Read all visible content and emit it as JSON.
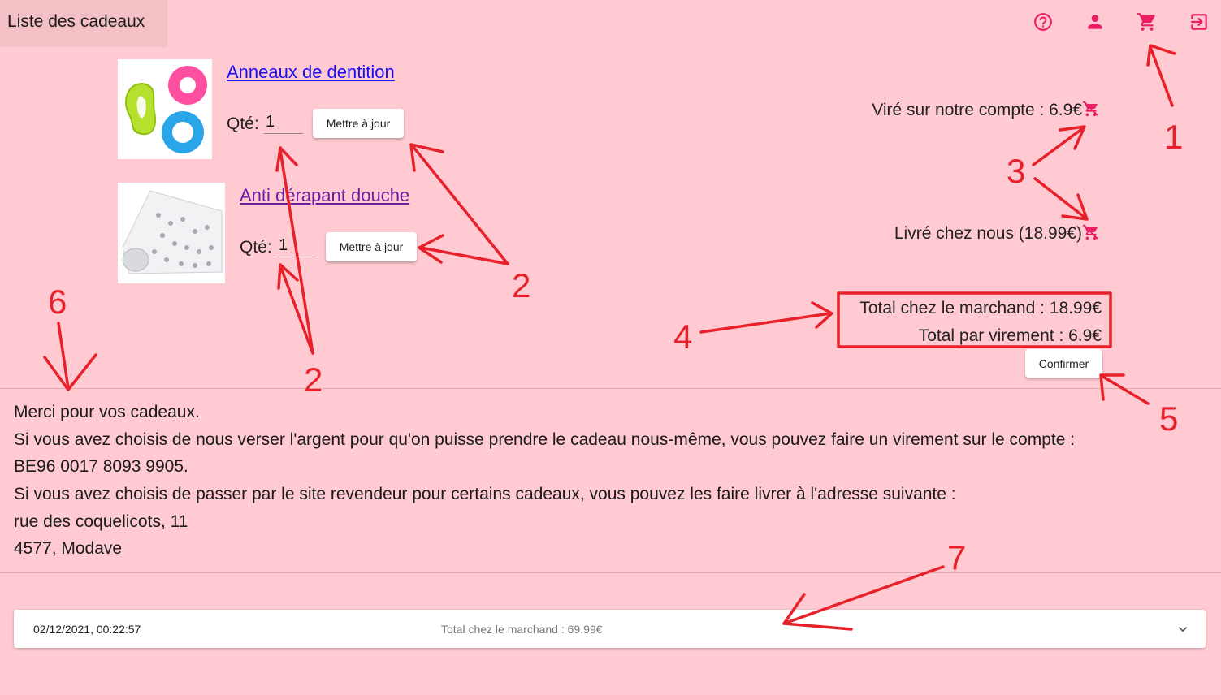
{
  "header": {
    "title": "Liste des cadeaux"
  },
  "toolbar_icons": [
    "help-icon",
    "account-icon",
    "cart-icon",
    "logout-icon"
  ],
  "accent_color": "#e91e63",
  "cart_items": [
    {
      "name": "Anneaux de dentition",
      "qty_label": "Qté:",
      "qty_value": "1",
      "update_label": "Mettre à jour"
    },
    {
      "name": "Anti dérapant douche",
      "qty_label": "Qté:",
      "qty_value": "1",
      "update_label": "Mettre à jour"
    }
  ],
  "options": {
    "transfer": "Viré sur notre compte : 6.9€",
    "delivered": "Livré chez nous (18.99€)"
  },
  "totals": {
    "merchant": "Total chez le marchand : 18.99€",
    "transfer": "Total par virement : 6.9€",
    "confirm_label": "Confirmer"
  },
  "message": {
    "line1": "Merci pour vos cadeaux.",
    "line2": "Si vous avez choisis de nous verser l'argent pour qu'on puisse prendre le cadeau nous-même, vous pouvez faire un virement sur le compte :",
    "line3": "BE96 0017 8093 9905.",
    "line4": "Si vous avez choisis de passer par le site revendeur pour certains cadeaux, vous pouvez les faire livrer à l'adresse suivante :",
    "line5": "rue des coquelicots, 11",
    "line6": "4577, Modave"
  },
  "history": {
    "date": "02/12/2021, 00:22:57",
    "total": "Total chez le marchand : 69.99€"
  },
  "annotations": [
    "1",
    "2",
    "2",
    "3",
    "4",
    "5",
    "6",
    "7"
  ]
}
